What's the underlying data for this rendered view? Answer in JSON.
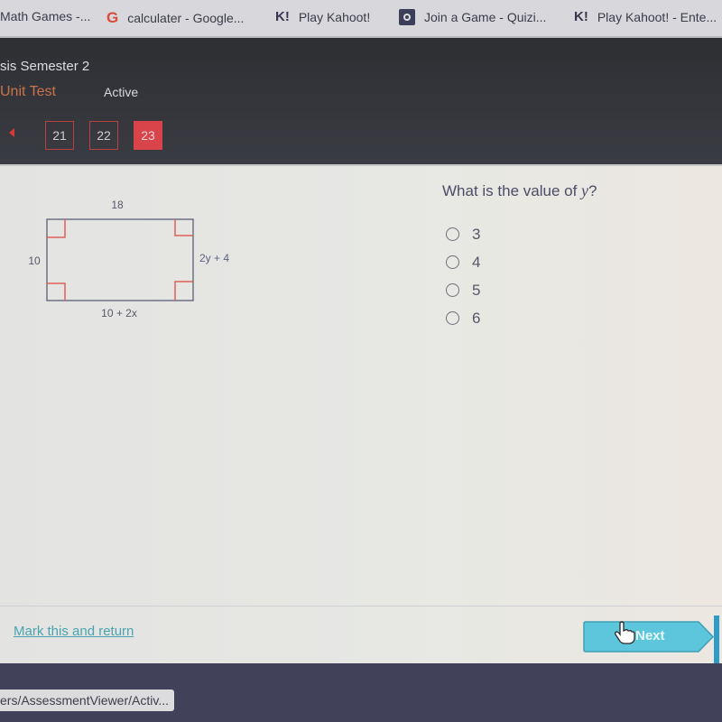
{
  "bookmarks": [
    {
      "label": "Math Games -...",
      "icon": "none"
    },
    {
      "label": "calculater - Google...",
      "icon": "google-icon",
      "glyph": "G"
    },
    {
      "label": "Play Kahoot!",
      "icon": "kahoot-icon",
      "glyph": "K!"
    },
    {
      "label": "Join a Game - Quizi...",
      "icon": "quizizz-icon"
    },
    {
      "label": "Play Kahoot! - Ente...",
      "icon": "kahoot-icon",
      "glyph": "K!"
    }
  ],
  "header": {
    "course_title": "sis Semester 2",
    "unit_label": "Unit Test",
    "status": "Active",
    "question_numbers": [
      {
        "label": "21",
        "active": false
      },
      {
        "label": "22",
        "active": false
      },
      {
        "label": "23",
        "active": true
      }
    ]
  },
  "diagram": {
    "top_label": "18",
    "left_label": "10",
    "right_label": "2y + 4",
    "bottom_label": "10 + 2x"
  },
  "question": {
    "prefix": "What is the value of ",
    "variable": "y",
    "suffix": "?",
    "options": [
      "3",
      "4",
      "5",
      "6"
    ],
    "selected": null
  },
  "footer": {
    "mark_link": "Mark this and return",
    "next_label": "Next"
  },
  "status_bar": {
    "url": "ers/AssessmentViewer/Activ..."
  },
  "colors": {
    "accent_red": "#d9434a",
    "next_button": "#56c3d9",
    "link": "#4aa3b0",
    "right_angle_marker": "#e0605a"
  }
}
